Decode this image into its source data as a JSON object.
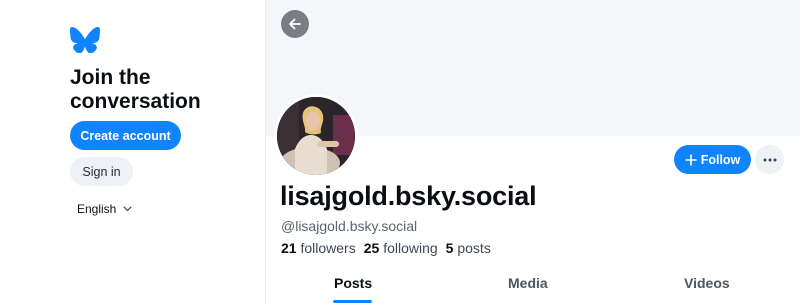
{
  "sidebar": {
    "logo_icon": "bluesky-butterfly-icon",
    "heading": "Join the conversation",
    "create_account_label": "Create account",
    "sign_in_label": "Sign in",
    "language": "English",
    "language_icon": "chevron-down-icon"
  },
  "colors": {
    "accent": "#1083fe",
    "banner": "#f4f6f9",
    "secondary_button": "#eef1f5",
    "text_primary": "#0b0f14",
    "text_secondary": "#5b6470"
  },
  "profile": {
    "back_icon": "arrow-left-icon",
    "avatar_icon": "profile-photo-avatar",
    "display_name": "lisajgold.bsky.social",
    "handle": "@lisajgold.bsky.social",
    "followers_count": "21",
    "followers_label": "followers",
    "following_count": "25",
    "following_label": "following",
    "posts_count": "5",
    "posts_label": "posts",
    "follow_label": "Follow",
    "follow_icon": "plus-icon",
    "more_icon": "ellipsis-icon"
  },
  "tabs": [
    {
      "label": "Posts",
      "active": true
    },
    {
      "label": "Media",
      "active": false
    },
    {
      "label": "Videos",
      "active": false
    }
  ]
}
